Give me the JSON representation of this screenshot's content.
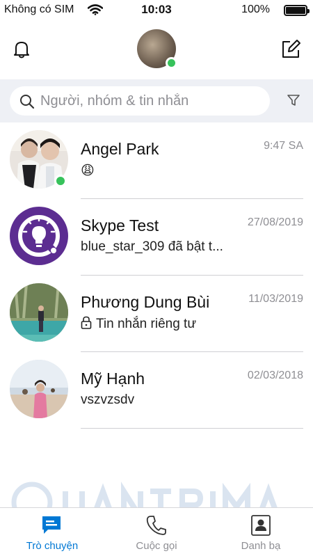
{
  "status_bar": {
    "carrier": "Không có SIM",
    "time": "10:03",
    "battery": "100%"
  },
  "header": {
    "left_icon": "bell-icon",
    "right_icon": "compose-icon",
    "profile_online": true
  },
  "search": {
    "placeholder": "Người, nhóm & tin nhắn"
  },
  "chats": [
    {
      "name": "Angel Park",
      "time": "9:47 SA",
      "preview": "😩",
      "online": true
    },
    {
      "name": "Skype Test",
      "time": "27/08/2019",
      "preview": "blue_star_309 đã bật t...",
      "online": false
    },
    {
      "name": "Phương Dung Bùi",
      "time": "11/03/2019",
      "preview": "Tin nhắn riêng tư",
      "preview_icon": "lock-icon",
      "online": false
    },
    {
      "name": "Mỹ Hạnh",
      "time": "02/03/2018",
      "preview": "vszvzsdv",
      "online": false
    }
  ],
  "tabs": [
    {
      "label": "Trò chuyện",
      "icon": "chat-icon",
      "active": true
    },
    {
      "label": "Cuộc gọi",
      "icon": "phone-icon",
      "active": false
    },
    {
      "label": "Danh bạ",
      "icon": "contacts-icon",
      "active": false
    }
  ],
  "colors": {
    "accent": "#0078d4",
    "online": "#37c25b",
    "search_bg": "#eef0f5",
    "skype_test_purple": "#5c2d91"
  }
}
